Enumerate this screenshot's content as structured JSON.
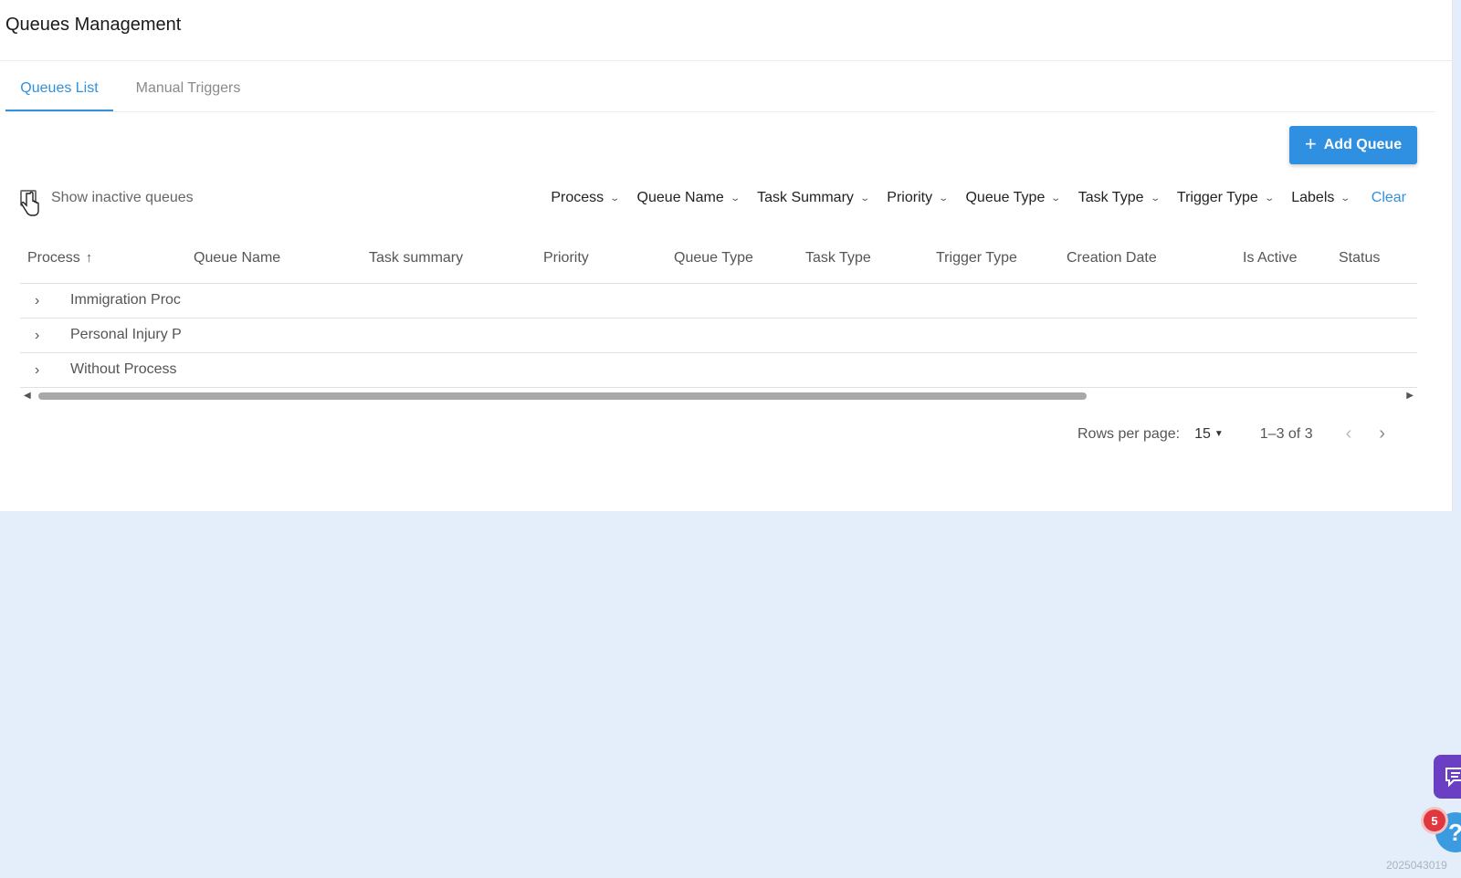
{
  "page": {
    "title": "Queues Management"
  },
  "tabs": [
    {
      "label": "Queues List",
      "active": true
    },
    {
      "label": "Manual Triggers",
      "active": false
    }
  ],
  "toolbar": {
    "add_button": "Add Queue"
  },
  "inactive_toggle": {
    "label": "Show inactive queues",
    "checked": false
  },
  "filters": {
    "items": [
      "Process",
      "Queue Name",
      "Task Summary",
      "Priority",
      "Queue Type",
      "Task Type",
      "Trigger Type",
      "Labels"
    ],
    "clear": "Clear"
  },
  "table": {
    "columns": [
      "Process",
      "Queue Name",
      "Task summary",
      "Priority",
      "Queue Type",
      "Task Type",
      "Trigger Type",
      "Creation Date",
      "Is Active",
      "Status"
    ],
    "sorted_column": "Process",
    "sort_direction": "ascending",
    "rows": [
      {
        "label": "Immigration Proc"
      },
      {
        "label": "Personal Injury P"
      },
      {
        "label": "Without Process"
      }
    ]
  },
  "pagination": {
    "rows_per_page_label": "Rows per page:",
    "rows_per_page": "15",
    "range": "1–3 of 3"
  },
  "widgets": {
    "badge_count": "5",
    "help_glyph": "?"
  },
  "watermark": "2025043019",
  "colors": {
    "accent": "#2f8fe0",
    "link": "#3390d9",
    "page_bg": "#e3eefa",
    "chat": "#6b3fc4",
    "badge": "#e0383e"
  }
}
